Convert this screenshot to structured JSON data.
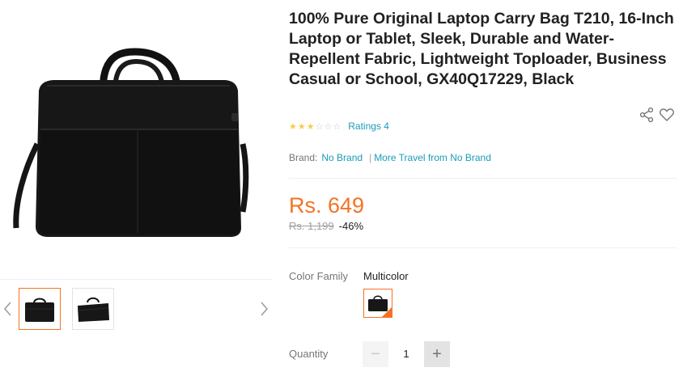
{
  "product": {
    "title": "100% Pure Original Laptop Carry Bag T210, 16-Inch Laptop or Tablet, Sleek, Durable and Water-Repellent Fabric, Lightweight Toploader, Business Casual or School, GX40Q17229, Black",
    "image_alt": "Black laptop carry bag"
  },
  "rating": {
    "stars": 3,
    "max_stars": 5,
    "ratings_text": "Ratings 4"
  },
  "brand": {
    "label": "Brand:",
    "name": "No Brand",
    "separator": "|",
    "more_link": "More Travel from No Brand"
  },
  "price": {
    "current": "Rs. 649",
    "original": "Rs. 1,199",
    "discount": "-46%"
  },
  "color_family": {
    "label": "Color Family",
    "value": "Multicolor"
  },
  "quantity": {
    "label": "Quantity",
    "value": "1",
    "minus_symbol": "−",
    "plus_symbol": "+"
  },
  "gallery": {
    "thumbnail_count": 2,
    "active_index": 0
  },
  "icons": {
    "share": "share-icon",
    "wishlist": "heart-icon",
    "prev": "chevron-left-icon",
    "next": "chevron-right-icon"
  },
  "colors": {
    "accent": "#f57224",
    "link": "#1a9cb7",
    "star": "#faca51",
    "muted": "#757575"
  }
}
